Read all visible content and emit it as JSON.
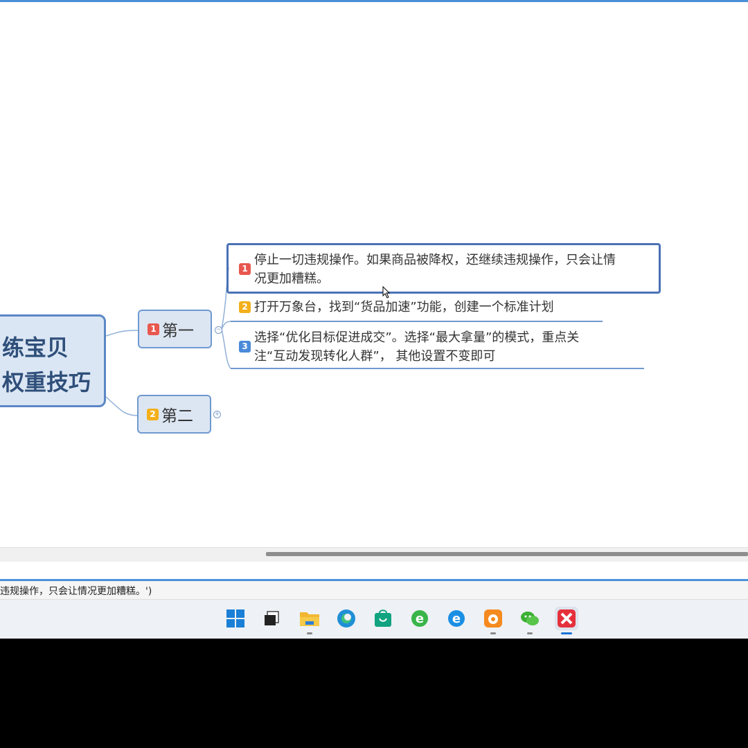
{
  "mindmap": {
    "root": {
      "line1": "练宝贝",
      "line2": "权重技巧"
    },
    "branches": [
      {
        "badge": "1",
        "label": "第一"
      },
      {
        "badge": "2",
        "label": "第二"
      }
    ],
    "leaves": [
      {
        "badge": "1",
        "line1": "停止一切违规操作。如果商品被降权，还继续违规操作，只会让情",
        "line2": "况更加糟糕。"
      },
      {
        "badge": "2",
        "line1": "打开万象台，找到“货品加速”功能，创建一个标准计划",
        "line2": ""
      },
      {
        "badge": "3",
        "line1": "选择“优化目标促进成交”。选择“最大拿量”的模式，重点关",
        "line2": "注“互动发现转化人群”， 其他设置不变即可"
      }
    ]
  },
  "statusbar": {
    "text": "违规操作，只会让情况更加糟糕。')"
  },
  "taskbar": {
    "icons": [
      "windows-start-icon",
      "task-view-icon",
      "file-explorer-icon",
      "edge-icon",
      "store-icon",
      "ie-green-icon",
      "ie-blue-icon",
      "uc-browser-icon",
      "wechat-icon",
      "xmind-icon"
    ]
  },
  "colors": {
    "accent": "#4a90d9",
    "node_border": "#6f99d0",
    "badge_red": "#e8584f",
    "badge_yellow": "#f3b01b",
    "badge_blue": "#4a8ad9"
  }
}
